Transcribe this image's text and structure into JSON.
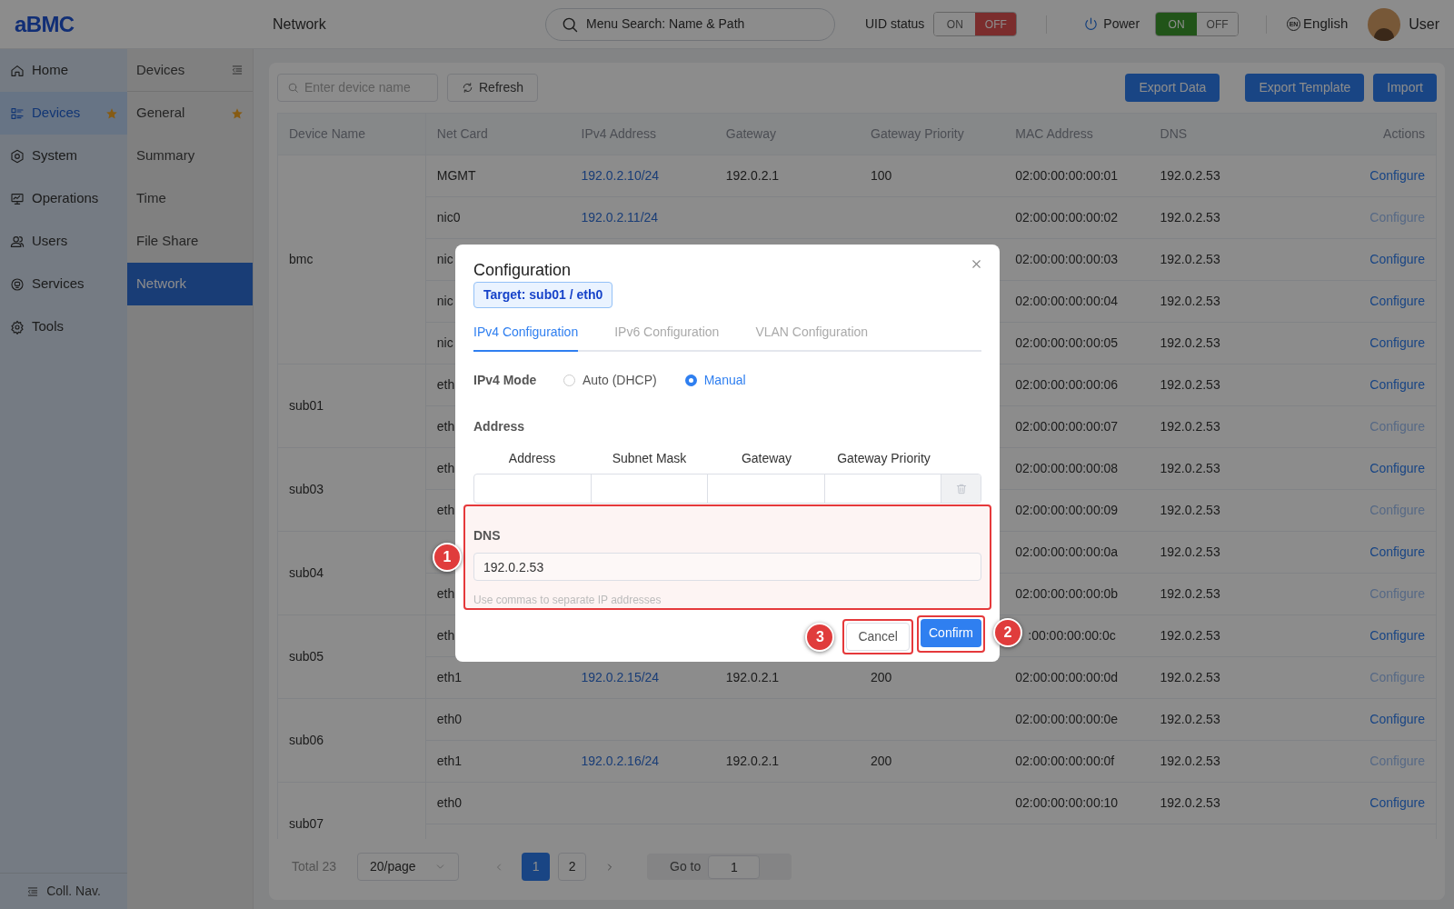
{
  "topbar": {
    "logo": "aBMC",
    "page_title": "Network",
    "search": {
      "placeholder": "Menu Search: Name & Path"
    },
    "uid_status": {
      "label": "UID status",
      "options": [
        {
          "label": "ON",
          "selected": false
        },
        {
          "label": "OFF",
          "selected": true
        }
      ]
    },
    "power": {
      "label": "Power",
      "options": [
        {
          "label": "ON",
          "selected": true
        },
        {
          "label": "OFF",
          "selected": false
        }
      ]
    },
    "language": {
      "icon_text": "EN",
      "label": "English"
    },
    "user": "User"
  },
  "nav": {
    "items": [
      {
        "label": "Home",
        "selected": false,
        "starred": false
      },
      {
        "label": "Devices",
        "selected": true,
        "starred": true
      },
      {
        "label": "System",
        "selected": false,
        "starred": false
      },
      {
        "label": "Operations",
        "selected": false,
        "starred": false
      },
      {
        "label": "Users",
        "selected": false,
        "starred": false
      },
      {
        "label": "Services",
        "selected": false,
        "starred": false
      },
      {
        "label": "Tools",
        "selected": false,
        "starred": false
      }
    ],
    "collapse": "Coll. Nav."
  },
  "subnav": {
    "title": "Devices",
    "items": [
      {
        "label": "General",
        "selected": false,
        "starred": true
      },
      {
        "label": "Summary",
        "selected": false,
        "starred": false
      },
      {
        "label": "Time",
        "selected": false,
        "starred": false
      },
      {
        "label": "File Share",
        "selected": false,
        "starred": false
      },
      {
        "label": "Network",
        "selected": true,
        "starred": false
      }
    ]
  },
  "toolbar": {
    "search": {
      "placeholder": "Enter device name"
    },
    "refresh": "Refresh",
    "buttons": [
      "Export Data",
      "Export Template",
      "Import"
    ]
  },
  "table": {
    "columns": [
      "Device Name",
      "Net Card",
      "IPv4 Address",
      "Gateway",
      "Gateway Priority",
      "MAC Address",
      "DNS",
      "Actions"
    ],
    "groups": [
      {
        "device": "bmc",
        "ports": [
          {
            "net_card": "MGMT",
            "ipv4": "192.0.2.10/24",
            "gateway": "192.0.2.1",
            "gateway_priority": "100",
            "mac": "02:00:00:00:00:01",
            "dns": "192.0.2.53",
            "action": "Configure",
            "disabled": false
          },
          {
            "net_card": "nic0",
            "ipv4": "192.0.2.11/24",
            "mac": "02:00:00:00:00:02",
            "dns": "192.0.2.53",
            "action": "Configure",
            "disabled": true
          },
          {
            "net_card": "nic",
            "mac": "02:00:00:00:00:03",
            "dns": "192.0.2.53",
            "action": "Configure",
            "disabled": false
          },
          {
            "net_card": "nic",
            "mac": "02:00:00:00:00:04",
            "dns": "192.0.2.53",
            "action": "Configure",
            "disabled": false
          },
          {
            "net_card": "nic",
            "mac": "02:00:00:00:00:05",
            "dns": "192.0.2.53",
            "action": "Configure",
            "disabled": false
          }
        ]
      },
      {
        "device": "sub01",
        "ports": [
          {
            "net_card": "eth",
            "mac": "02:00:00:00:00:06",
            "dns": "192.0.2.53",
            "action": "Configure",
            "disabled": false
          },
          {
            "net_card": "eth",
            "mac": "02:00:00:00:00:07",
            "dns": "192.0.2.53",
            "action": "Configure",
            "disabled": true
          }
        ]
      },
      {
        "device": "sub03",
        "ports": [
          {
            "net_card": "eth",
            "mac": "02:00:00:00:00:08",
            "dns": "192.0.2.53",
            "action": "Configure",
            "disabled": false
          },
          {
            "net_card": "eth",
            "mac": "02:00:00:00:00:09",
            "dns": "192.0.2.53",
            "action": "Configure",
            "disabled": true
          }
        ]
      },
      {
        "device": "sub04",
        "ports": [
          {
            "mac": "02:00:00:00:00:0a",
            "dns": "192.0.2.53",
            "action": "Configure",
            "disabled": false
          },
          {
            "net_card": "eth",
            "mac": "02:00:00:00:00:0b",
            "dns": "192.0.2.53",
            "action": "Configure",
            "disabled": true
          }
        ]
      },
      {
        "device": "sub05",
        "ports": [
          {
            "net_card": "eth",
            "mac": ":00:00:00:00:0c",
            "dns": "192.0.2.53",
            "action": "Configure",
            "disabled": false
          },
          {
            "net_card": "eth1",
            "ipv4": "192.0.2.15/24",
            "gateway": "192.0.2.1",
            "gateway_priority": "200",
            "mac": "02:00:00:00:00:0d",
            "dns": "192.0.2.53",
            "action": "Configure",
            "disabled": true
          }
        ]
      },
      {
        "device": "sub06",
        "ports": [
          {
            "net_card": "eth0",
            "mac": "02:00:00:00:00:0e",
            "dns": "192.0.2.53",
            "action": "Configure",
            "disabled": false
          },
          {
            "net_card": "eth1",
            "ipv4": "192.0.2.16/24",
            "gateway": "192.0.2.1",
            "gateway_priority": "200",
            "mac": "02:00:00:00:00:0f",
            "dns": "192.0.2.53",
            "action": "Configure",
            "disabled": true
          }
        ]
      },
      {
        "device": "sub07",
        "ports": [
          {
            "net_card": "eth0",
            "mac": "02:00:00:00:00:10",
            "dns": "192.0.2.53",
            "action": "Configure",
            "disabled": false
          }
        ]
      }
    ]
  },
  "pagination": {
    "total": "Total 23",
    "page_size": "20/page",
    "pages": [
      {
        "label": "1",
        "selected": true
      },
      {
        "label": "2",
        "selected": false
      }
    ],
    "goto_label": "Go to",
    "goto_value": "1"
  },
  "dialog": {
    "title": "Configuration",
    "target": "Target: sub01 / eth0",
    "tabs": [
      {
        "label": "IPv4 Configuration",
        "selected": true
      },
      {
        "label": "IPv6 Configuration",
        "selected": false
      },
      {
        "label": "VLAN Configuration",
        "selected": false
      }
    ],
    "mode_label": "IPv4 Mode",
    "modes": [
      {
        "label": "Auto (DHCP)",
        "selected": false
      },
      {
        "label": "Manual",
        "selected": true
      }
    ],
    "address_label": "Address",
    "address_columns": [
      "Address",
      "Subnet Mask",
      "Gateway",
      "Gateway Priority"
    ],
    "dns": {
      "label": "DNS",
      "value": "192.0.2.53",
      "hint": "Use commas to separate IP addresses",
      "marker": "1"
    },
    "cancel": {
      "label": "Cancel",
      "marker": "3"
    },
    "confirm": {
      "label": "Confirm",
      "marker": "2"
    }
  }
}
